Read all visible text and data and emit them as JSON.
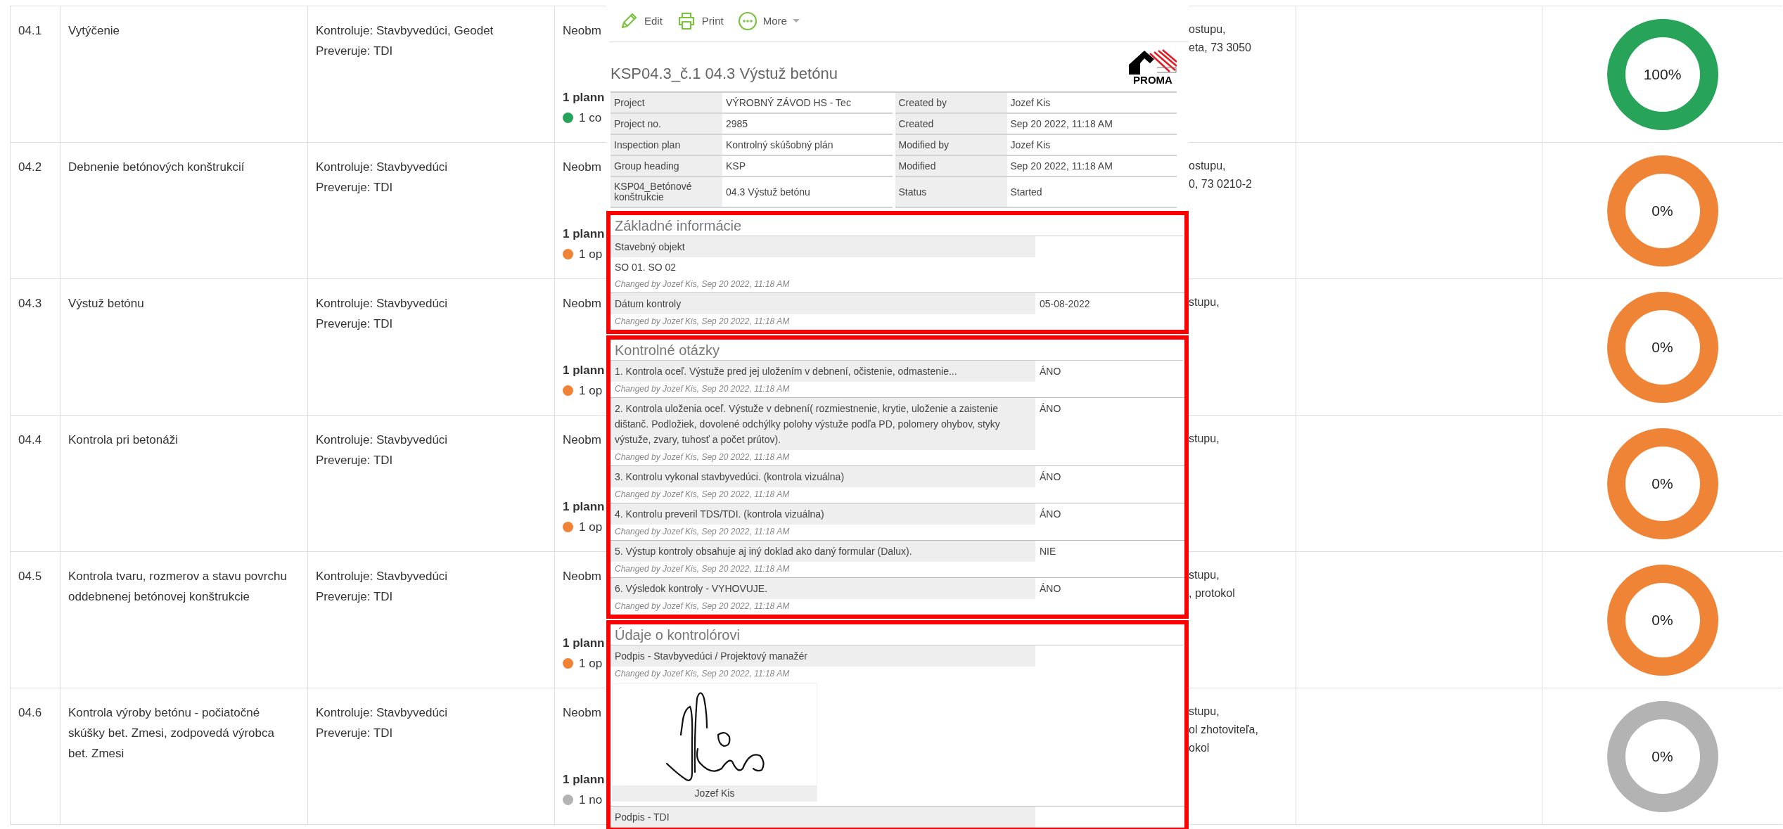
{
  "table": {
    "rows": [
      {
        "code": "04.1",
        "name": "Vytýčenie",
        "roles": [
          "Kontroluje: Stavbyvedúci, Geodet",
          "Preveruje: TDI"
        ],
        "column_4": "Neobm",
        "planned": "1 plann",
        "status": {
          "text": "1 co",
          "color": "#27a35a"
        },
        "column_5": [
          "ostupu,",
          "eta, 73 3050"
        ],
        "progress": {
          "label": "100%",
          "color": "#27a35a"
        }
      },
      {
        "code": "04.2",
        "name": "Debnenie betónových konštrukcií",
        "roles": [
          "Kontroluje: Stavbyvedúci",
          "Preveruje: TDI"
        ],
        "column_4": "Neobm",
        "planned": "1 plann",
        "status": {
          "text": "1 op",
          "color": "#f08436"
        },
        "column_5": [
          "ostupu,",
          "0, 73 0210-2"
        ],
        "progress": {
          "label": "0%",
          "color": "#f08436"
        }
      },
      {
        "code": "04.3",
        "name": "Výstuž betónu",
        "roles": [
          "Kontroluje: Stavbyvedúci",
          "Preveruje: TDI"
        ],
        "column_4": "Neobm",
        "planned": "1 plann",
        "status": {
          "text": "1 op",
          "color": "#f08436"
        },
        "column_5": [
          "stupu,"
        ],
        "progress": {
          "label": "0%",
          "color": "#f08436"
        }
      },
      {
        "code": "04.4",
        "name": "Kontrola pri betonáži",
        "roles": [
          "Kontroluje: Stavbyvedúci",
          "Preveruje: TDI"
        ],
        "column_4": "Neobm",
        "planned": "1 plann",
        "status": {
          "text": "1 op",
          "color": "#f08436"
        },
        "column_5": [
          "stupu,"
        ],
        "progress": {
          "label": "0%",
          "color": "#f08436"
        }
      },
      {
        "code": "04.5",
        "name": "Kontrola tvaru, rozmerov a stavu povrchu oddebnenej betónovej konštrukcie",
        "roles": [
          "Kontroluje: Stavbyvedúci",
          "Preveruje: TDI"
        ],
        "column_4": "Neobm",
        "planned": "1 plann",
        "status": {
          "text": "1 op",
          "color": "#f08436"
        },
        "column_5": [
          "stupu,",
          ", protokol"
        ],
        "progress": {
          "label": "0%",
          "color": "#f08436"
        }
      },
      {
        "code": "04.6",
        "name": "Kontrola výroby betónu - počiatočné skúšky bet. Zmesi, zodpovedá výrobca bet. Zmesi",
        "roles": [
          "Kontroluje: Stavbyvedúci",
          "Preveruje: TDI"
        ],
        "column_4": "Neobm",
        "planned": "1 plann",
        "status": {
          "text": "1 no",
          "color": "#b3b3b3"
        },
        "column_5": [
          "stupu,",
          "ol zhotoviteľa,",
          "okol"
        ],
        "progress": {
          "label": "0%",
          "color": "#b3b3b3"
        }
      }
    ]
  },
  "toolbar": [
    {
      "kind": "edit",
      "label": "Edit"
    },
    {
      "kind": "print",
      "label": "Print"
    },
    {
      "kind": "more",
      "label": "More"
    }
  ],
  "document": {
    "title": "KSP04.3_č.1 04.3 Výstuž betónu",
    "logo": "PROMA",
    "meta": [
      {
        "cells": [
          {
            "label": "Project",
            "value": "VÝROBNÝ ZÁVOD HS - Tec"
          },
          {
            "label": "Created by",
            "value": "Jozef Kis"
          }
        ]
      },
      {
        "cells": [
          {
            "label": "Project no.",
            "value": "2985"
          },
          {
            "label": "Created",
            "value": "Sep 20 2022, 11:18 AM"
          }
        ]
      },
      {
        "cells": [
          {
            "label": "Inspection plan",
            "value": "Kontrolný skúšobný plán"
          },
          {
            "label": "Modified by",
            "value": "Jozef Kis"
          }
        ]
      },
      {
        "cells": [
          {
            "label": "Group heading",
            "value": "KSP"
          },
          {
            "label": "Modified",
            "value": "Sep 20 2022, 11:18 AM"
          }
        ]
      },
      {
        "cells": [
          {
            "label": "KSP04_Betónové konštrukcie",
            "value": "04.3 Výstuž betónu"
          },
          {
            "label": "Status",
            "value": "Started"
          }
        ]
      }
    ],
    "sections": [
      {
        "heading": "Základné informácie",
        "fields": [
          {
            "kind": "block",
            "label": "Stavebný objekt",
            "value": "SO 01. SO 02",
            "changed": "Changed by Jozef Kis, Sep 20 2022, 11:18 AM"
          },
          {
            "kind": "answer",
            "label": "Dátum kontroly",
            "value": "05-08-2022",
            "changed": "Changed by Jozef Kis, Sep 20 2022, 11:18 AM"
          }
        ]
      },
      {
        "heading": "Kontrolné otázky",
        "fields": [
          {
            "kind": "answer",
            "label": "1. Kontrola oceľ. Výstuže pred jej uložením v debnení, očistenie, odmastenie...",
            "value": "ÁNO",
            "changed": "Changed by Jozef Kis, Sep 20 2022, 11:18 AM"
          },
          {
            "kind": "answer",
            "label": "2. Kontrola uloženia oceľ. Výstuže v debnení( rozmiestnenie, krytie, uloženie a zaistenie dištanč. Podložiek, dovolené odchýlky polohy výstuže podľa PD, polomery ohybov, styky výstuže, zvary, tuhosť a počet prútov).",
            "value": "ÁNO",
            "changed": "Changed by Jozef Kis, Sep 20 2022, 11:18 AM"
          },
          {
            "kind": "answer",
            "label": "3. Kontrolu vykonal stavbyvedúci. (kontrola vizuálna)",
            "value": "ÁNO",
            "changed": "Changed by Jozef Kis, Sep 20 2022, 11:18 AM"
          },
          {
            "kind": "answer",
            "label": "4. Kontrolu preveril TDS/TDI. (kontrola vizuálna)",
            "value": "ÁNO",
            "changed": "Changed by Jozef Kis, Sep 20 2022, 11:18 AM"
          },
          {
            "kind": "answer",
            "label": "5. Výstup kontroly obsahuje aj iný doklad ako daný formular (Dalux).",
            "value": "NIE",
            "changed": "Changed by Jozef Kis, Sep 20 2022, 11:18 AM"
          },
          {
            "kind": "answer",
            "label": "6. Výsledok kontroly - VYHOVUJE.",
            "value": "ÁNO",
            "changed": "Changed by Jozef Kis, Sep 20 2022, 11:18 AM"
          }
        ]
      },
      {
        "heading": "Údaje o kontrolórovi",
        "fields": [
          {
            "kind": "signature",
            "label": "Podpis - Stavbyvedúci / Projektový manažér",
            "changed": "Changed by Jozef Kis, Sep 20 2022, 11:18 AM",
            "signer": "Jozef Kis"
          },
          {
            "kind": "answer",
            "label": "Podpis - TDI"
          }
        ]
      }
    ]
  }
}
